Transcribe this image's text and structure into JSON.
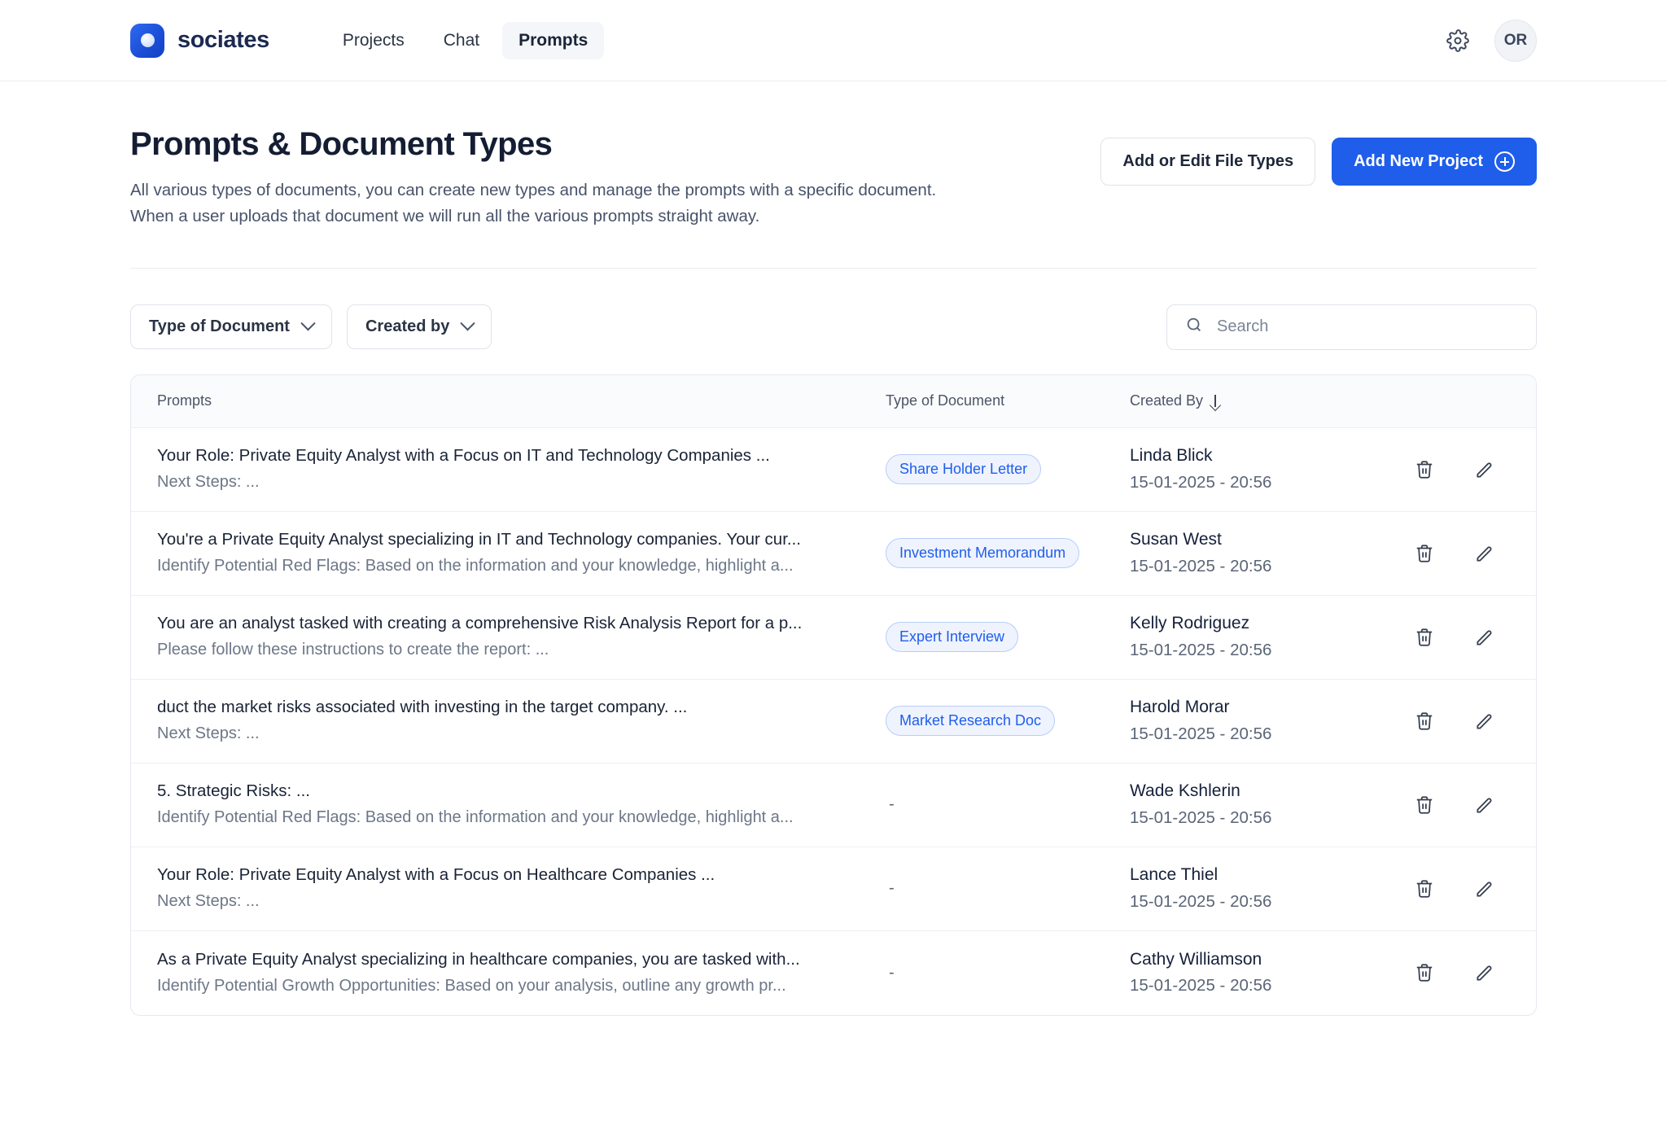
{
  "brand": {
    "name": "sociates",
    "logo_icon": "sociates-logo-icon"
  },
  "nav": {
    "items": [
      {
        "label": "Projects",
        "active": false
      },
      {
        "label": "Chat",
        "active": false
      },
      {
        "label": "Prompts",
        "active": true
      }
    ],
    "settings_icon": "gear-icon",
    "avatar_initials": "OR"
  },
  "header": {
    "title": "Prompts & Document Types",
    "subtitle_line1": "All various types of documents, you can create new types and manage the prompts with a specific document.",
    "subtitle_line2": "When a user uploads that document we will run all the various prompts straight away.",
    "secondary_button": "Add or Edit File Types",
    "primary_button": "Add New Project",
    "primary_button_icon": "plus-circle-icon"
  },
  "toolbar": {
    "filters": [
      {
        "label": "Type of Document",
        "icon": "chevron-down-icon"
      },
      {
        "label": "Created by",
        "icon": "chevron-down-icon"
      }
    ],
    "search": {
      "placeholder": "Search",
      "value": "",
      "icon": "search-icon"
    }
  },
  "table": {
    "columns": {
      "prompts": "Prompts",
      "type": "Type of Document",
      "created_by": "Created By",
      "sort_icon": "arrow-down-icon"
    },
    "row_actions": {
      "delete_icon": "trash-icon",
      "edit_icon": "pencil-icon"
    },
    "rows": [
      {
        "prompt_main": "Your Role: Private Equity Analyst with a Focus on IT and Technology Companies ...",
        "prompt_sub": " Next Steps: ...",
        "type": "Share Holder Letter",
        "author": "Linda Blick",
        "date": "15-01-2025 - 20:56"
      },
      {
        "prompt_main": "You're a Private Equity Analyst specializing in IT and Technology companies. Your cur...",
        "prompt_sub": "Identify Potential Red Flags: Based on the information and your knowledge, highlight a...",
        "type": "Investment Memorandum",
        "author": "Susan West",
        "date": "15-01-2025 - 20:56"
      },
      {
        "prompt_main": "You are an analyst tasked with creating a comprehensive Risk Analysis Report for a p...",
        "prompt_sub": "Please follow these instructions to create the report: ...",
        "type": "Expert Interview",
        "author": "Kelly Rodriguez",
        "date": "15-01-2025 - 20:56"
      },
      {
        "prompt_main": "duct the market risks associated with investing in the target company. ...",
        "prompt_sub": " Next Steps: ...",
        "type": "Market Research Doc",
        "author": "Harold Morar",
        "date": "15-01-2025 - 20:56"
      },
      {
        "prompt_main": " 5. Strategic Risks: ...",
        "prompt_sub": "Identify Potential Red Flags: Based on the information and your knowledge, highlight a...",
        "type": "-",
        "author": "Wade Kshlerin",
        "date": "15-01-2025 - 20:56"
      },
      {
        "prompt_main": "Your Role: Private Equity Analyst with a Focus on Healthcare Companies ...",
        "prompt_sub": " Next Steps: ...",
        "type": "-",
        "author": "Lance Thiel",
        "date": "15-01-2025 - 20:56"
      },
      {
        "prompt_main": "As a Private Equity Analyst specializing in healthcare companies, you are tasked with...",
        "prompt_sub": "Identify Potential Growth Opportunities: Based on your analysis, outline any growth pr...",
        "type": "-",
        "author": "Cathy Williamson",
        "date": "15-01-2025 - 20:56"
      }
    ]
  },
  "colors": {
    "accent": "#1f5eeb",
    "tag_bg": "#eef3fe",
    "tag_border": "#b9cdf8",
    "text_dark": "#141d33",
    "text_muted": "#6d7788"
  }
}
